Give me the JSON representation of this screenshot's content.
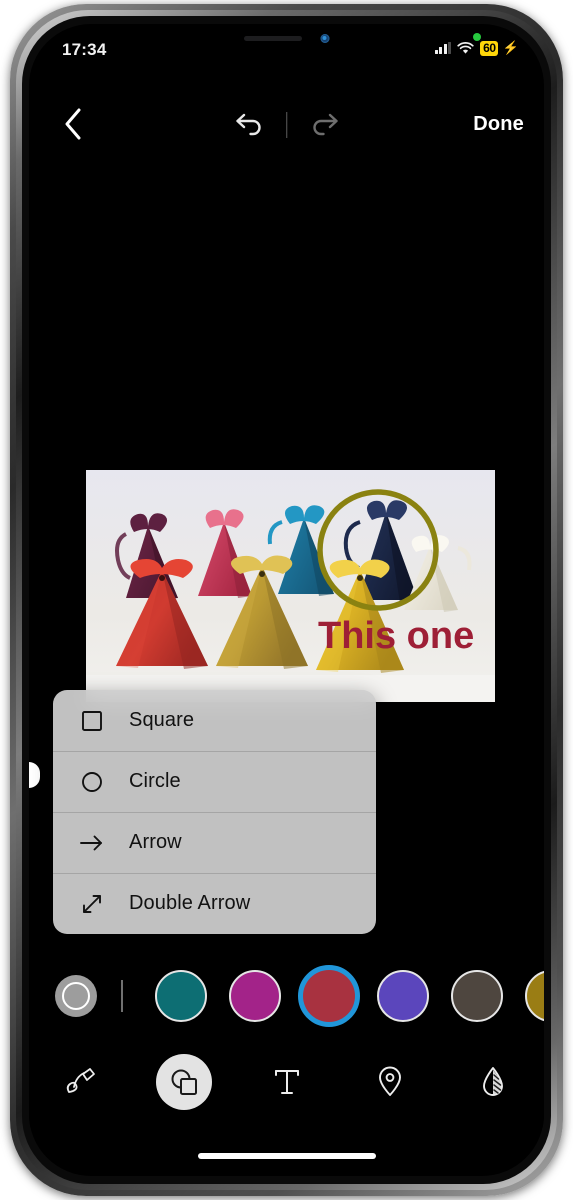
{
  "status_bar": {
    "time": "17:34",
    "battery_level": "60",
    "battery_charging": true,
    "battery_color": "#ffd60a",
    "recording_dot_color": "#27c93f",
    "signal_icon": "cellular-signal-icon",
    "wifi_icon": "wifi-icon",
    "charging_bolt_icon": "charging-bolt-icon"
  },
  "top_nav": {
    "back_icon": "chevron-left-icon",
    "undo_icon": "undo-icon",
    "redo_icon": "redo-icon",
    "done_label": "Done",
    "undo_enabled": true,
    "redo_enabled": false
  },
  "canvas": {
    "annotation_text": "This one",
    "annotation_text_color": "#9e1f36",
    "circle_annotation_color": "#8a8211",
    "photo_description": "pyramid gift boxes with ribbons",
    "photo_background": "#e9e9ee"
  },
  "shape_menu": {
    "items": [
      {
        "label": "Square",
        "icon": "square-icon"
      },
      {
        "label": "Circle",
        "icon": "circle-icon"
      },
      {
        "label": "Arrow",
        "icon": "arrow-right-icon"
      },
      {
        "label": "Double Arrow",
        "icon": "double-arrow-icon"
      }
    ]
  },
  "palette": {
    "picker_label": "color-picker",
    "picker_color": "#9d9d9d",
    "selection_ring_color": "#2196d9",
    "swatches": [
      {
        "name": "teal",
        "color": "#0d6e73",
        "selected": false
      },
      {
        "name": "magenta",
        "color": "#a32389",
        "selected": false
      },
      {
        "name": "red",
        "color": "#a83240",
        "selected": true
      },
      {
        "name": "purple",
        "color": "#5b46bc",
        "selected": false
      },
      {
        "name": "brown",
        "color": "#4e463f",
        "selected": false
      },
      {
        "name": "gold",
        "color": "#9a7d14",
        "selected": false
      }
    ]
  },
  "toolbar": {
    "tools": [
      {
        "name": "draw",
        "icon": "pen-icon",
        "active": false
      },
      {
        "name": "shapes",
        "icon": "shapes-icon",
        "active": true
      },
      {
        "name": "text",
        "icon": "text-icon",
        "active": false
      },
      {
        "name": "location",
        "icon": "location-pin-icon",
        "active": false
      },
      {
        "name": "blur",
        "icon": "blur-drop-icon",
        "active": false
      }
    ]
  }
}
